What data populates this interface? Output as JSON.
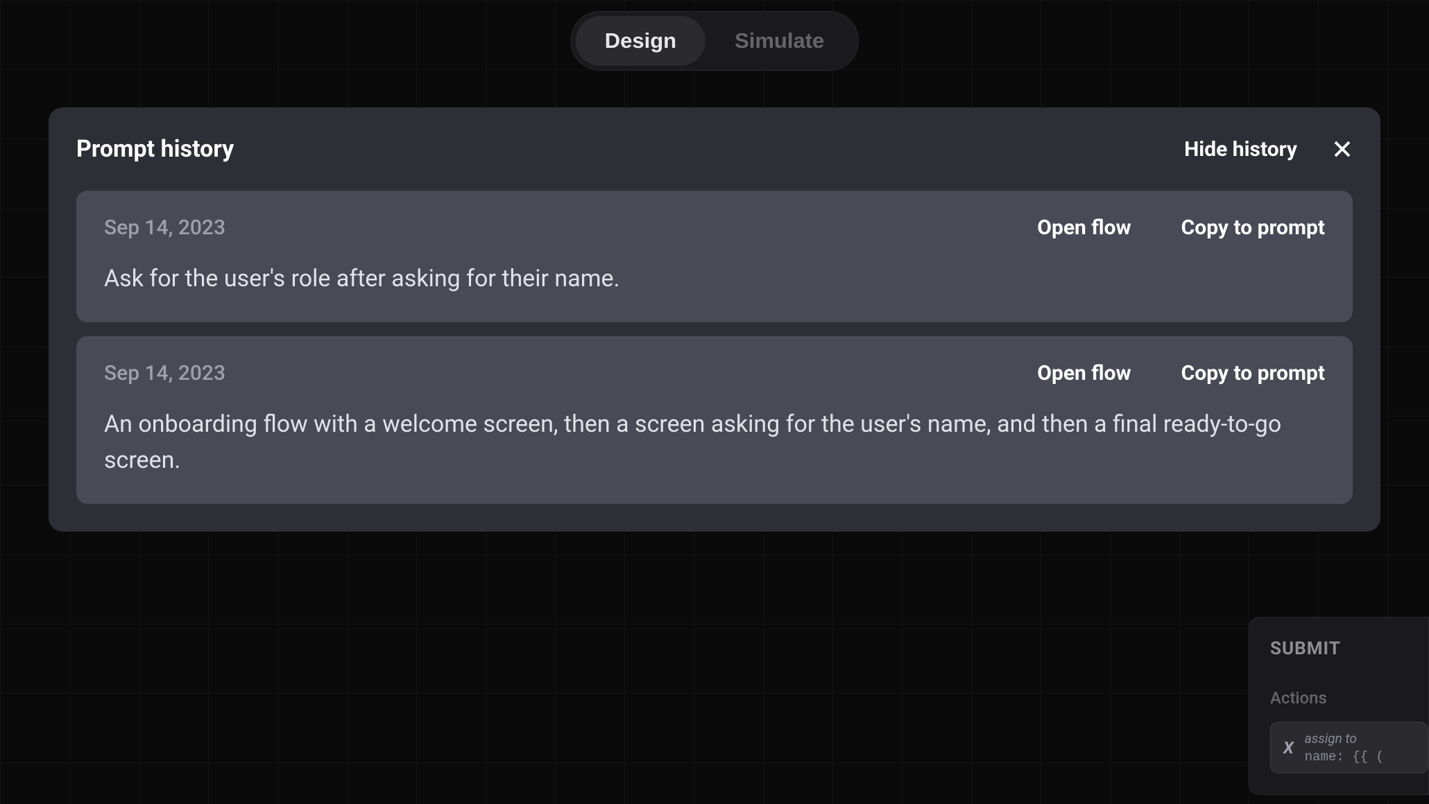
{
  "tabs": {
    "design": "Design",
    "simulate": "Simulate"
  },
  "modal": {
    "title": "Prompt history",
    "hide_label": "Hide history"
  },
  "history": [
    {
      "date": "Sep 14, 2023",
      "open_flow_label": "Open flow",
      "copy_label": "Copy to prompt",
      "text": "Ask for the user's role after asking for their name."
    },
    {
      "date": "Sep 14, 2023",
      "open_flow_label": "Open flow",
      "copy_label": "Copy to prompt",
      "text": "An onboarding flow with a welcome screen, then a screen asking for the user's name, and then a final ready-to-go screen."
    }
  ],
  "background_panel": {
    "submit": "SUBMIT",
    "actions_label": "Actions",
    "action_assign_label": "assign to",
    "action_name_key": "name:",
    "action_value": "{{ ("
  }
}
